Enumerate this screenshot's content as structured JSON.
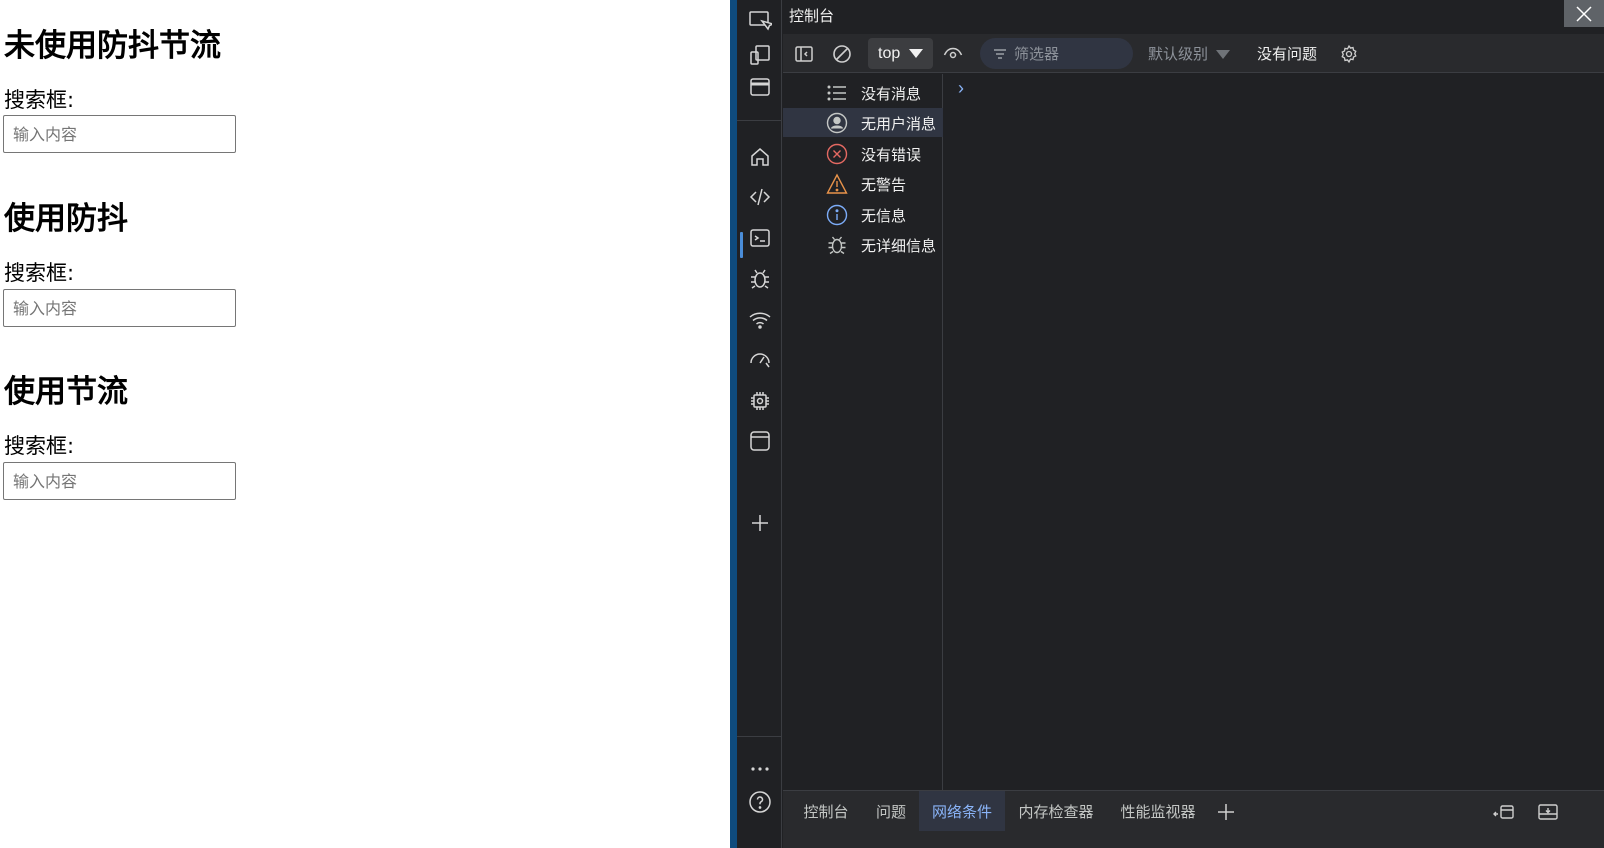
{
  "page": {
    "sections": [
      {
        "title": "未使用防抖节流",
        "label": "搜索框:",
        "placeholder": "输入内容"
      },
      {
        "title": "使用防抖",
        "label": "搜索框:",
        "placeholder": "输入内容"
      },
      {
        "title": "使用节流",
        "label": "搜索框:",
        "placeholder": "输入内容"
      }
    ]
  },
  "devtools": {
    "title": "控制台",
    "toolbar": {
      "context": "top",
      "filter_placeholder": "筛选器",
      "level": "默认级别",
      "issues": "没有问题"
    },
    "sidebar": [
      {
        "label": "没有消息",
        "icon": "list-icon"
      },
      {
        "label": "无用户消息",
        "icon": "user-icon"
      },
      {
        "label": "没有错误",
        "icon": "error-icon"
      },
      {
        "label": "无警告",
        "icon": "warning-icon"
      },
      {
        "label": "无信息",
        "icon": "info-icon"
      },
      {
        "label": "无详细信息",
        "icon": "bug-icon"
      }
    ],
    "drawer_tabs": [
      "控制台",
      "问题",
      "网络条件",
      "内存检查器",
      "性能监视器"
    ],
    "active_drawer_tab": "网络条件",
    "colors": {
      "accent": "#8ab4f8",
      "error": "#e46962",
      "warning": "#e8934a",
      "info": "#7cacf8",
      "divider": "#0f4b7d"
    }
  }
}
